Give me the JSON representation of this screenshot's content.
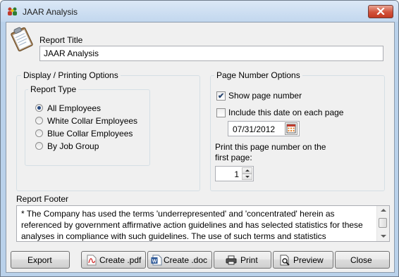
{
  "window": {
    "title": "JAAR Analysis",
    "close_glyph": "close-icon"
  },
  "report_title": {
    "label": "Report Title",
    "value": "JAAR Analysis"
  },
  "display_options": {
    "legend": "Display / Printing Options",
    "report_type": {
      "legend": "Report Type",
      "options": [
        {
          "label": "All Employees",
          "selected": true
        },
        {
          "label": "White Collar Employees",
          "selected": false
        },
        {
          "label": "Blue Collar Employees",
          "selected": false
        },
        {
          "label": "By Job Group",
          "selected": false
        }
      ]
    }
  },
  "page_number_options": {
    "legend": "Page Number Options",
    "show_page_number": {
      "label": "Show page number",
      "checked": true
    },
    "include_date": {
      "label": "Include this date on each page",
      "checked": false
    },
    "date_value": "07/31/2012",
    "print_page_label": "Print this page number on the first page:",
    "page_number_value": "1"
  },
  "report_footer": {
    "label": "Report Footer",
    "text": "* The Company has used the terms 'underrepresented' and 'concentrated' herein as referenced by government affirmative action guidelines and has selected statistics for these analyses in compliance with such guidelines. The use of such terms and statistics"
  },
  "buttons": {
    "export": "Export",
    "create_pdf": "Create .pdf",
    "create_doc": "Create .doc",
    "print": "Print",
    "preview": "Preview",
    "close": "Close"
  },
  "colors": {
    "titlebar": "#c8dcf0",
    "close_button": "#d2523b",
    "dialog_background": "#f0f0f0"
  }
}
